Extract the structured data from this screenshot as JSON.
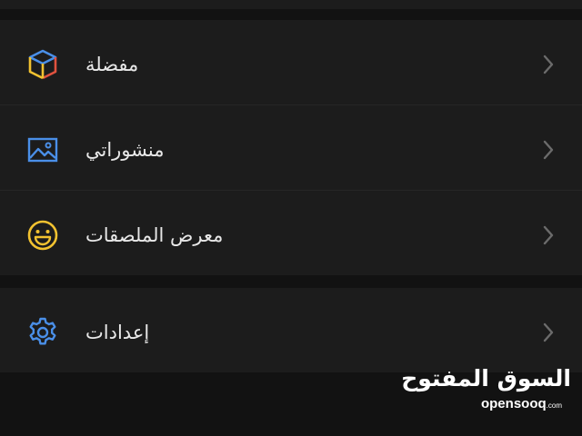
{
  "menu": {
    "items": [
      {
        "label": "مفضلة",
        "icon": "cube-icon"
      },
      {
        "label": "منشوراتي",
        "icon": "image-icon"
      },
      {
        "label": "معرض الملصقات",
        "icon": "smiley-icon"
      }
    ],
    "settings": {
      "label": "إعدادات",
      "icon": "gear-icon"
    }
  },
  "branding": {
    "logo_ar": "السوق المفتوح",
    "logo_en": "opensooq",
    "logo_suffix": ".com"
  },
  "colors": {
    "background": "#121212",
    "card": "#1c1c1c",
    "text": "#e8e8e8",
    "chevron": "#6b6b6b",
    "icon_blue": "#4a8fe8",
    "icon_yellow": "#f2c230",
    "icon_red": "#e0523f"
  }
}
